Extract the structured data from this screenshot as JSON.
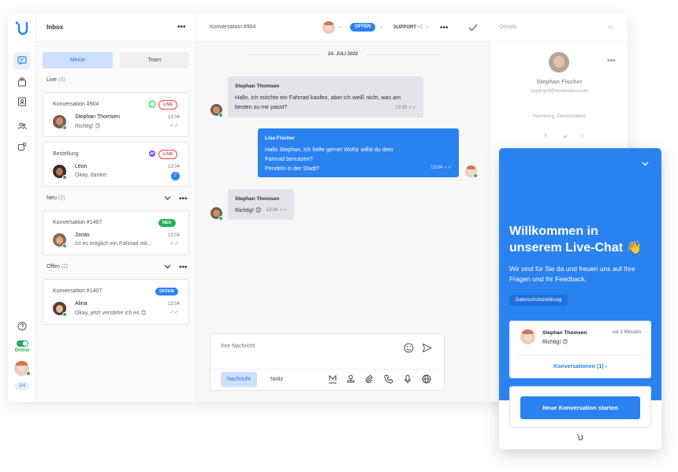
{
  "inbox": {
    "title": "Inbox",
    "tabs": [
      "Meine",
      "Team"
    ],
    "sections": {
      "live": {
        "label": "Live",
        "count": "(3)"
      },
      "neu": {
        "label": "Neu",
        "count": "(2)"
      },
      "offen": {
        "label": "Offen",
        "count": "(2)"
      }
    },
    "cards": [
      {
        "title": "Konversation #904",
        "badge": "LIVE",
        "name": "Stephan Thomsen",
        "message": "Richtig! 😊",
        "time": "13:04",
        "channel_icon": "whatsapp-icon"
      },
      {
        "title": "Bestellung",
        "badge": "LIVE",
        "name": "Leon",
        "message": "Okay, danke!",
        "time": "13:04",
        "unread": "2",
        "channel_icon": "messenger-icon"
      },
      {
        "title": "Konversation #1407",
        "badge": "NEU",
        "name": "Jonas",
        "message": "Ist es möglich ein Fahrrad mit...",
        "time": "13:04"
      },
      {
        "title": "Konversation #1407",
        "badge": "OFFEN",
        "name": "Alina",
        "message": "Okay, jetzt verstehe ich es 😊",
        "time": "13:04"
      }
    ]
  },
  "sidebar": {
    "status_label": "Online",
    "pager": "2/4"
  },
  "chat": {
    "title": "Konversation #904",
    "status_pill": "OFFEN",
    "team_pill": "SUPPORT",
    "team_extra": "+2",
    "date": "24. JULI 2022",
    "messages": [
      {
        "sender": "Stephan Thomsen",
        "text": "Hallo, ich möchte ein Fahrrad kaufen, aber ich weiß nicht, was am besten zu mir passt?",
        "time": "13:03",
        "direction": "in"
      },
      {
        "sender": "Lisa Fischer",
        "text_lines": [
          "Hallo Stephan, ich helfe gerne! Wofür willst du dein",
          "Fahrrad benutzen?",
          "Pendeln in der Stadt?"
        ],
        "time": "13:04",
        "direction": "out"
      },
      {
        "sender": "Stephan Thomsen",
        "text": "Richtig! 😊",
        "time": "13:04",
        "direction": "in"
      }
    ],
    "composer": {
      "placeholder": "Ihre Nachricht",
      "tab_message": "Nachricht",
      "tab_note": "Notiz"
    }
  },
  "details": {
    "title": "Details",
    "name": "Stephan Fischer",
    "email": "stephanf@webinator.com",
    "location": "Hamburg, Deutschland"
  },
  "widget": {
    "title": "Willkommen in unserem Live-Chat 👋",
    "subtitle": "Wir sind für Sie da und freuen uns auf Ihre Fragen und Ihr Feedback.",
    "privacy": "Datenschutzerklärung",
    "recent": {
      "name": "Stephan Thomsen",
      "time": "vor 2 Minuten",
      "message": "Richtig! 😊",
      "link": "Konversationen (1)"
    },
    "start_button": "Neue Konversation starten"
  },
  "colors": {
    "accent": "#2a82f0",
    "live": "#e74c3c",
    "neu": "#22b35a",
    "online": "#27ae60"
  }
}
